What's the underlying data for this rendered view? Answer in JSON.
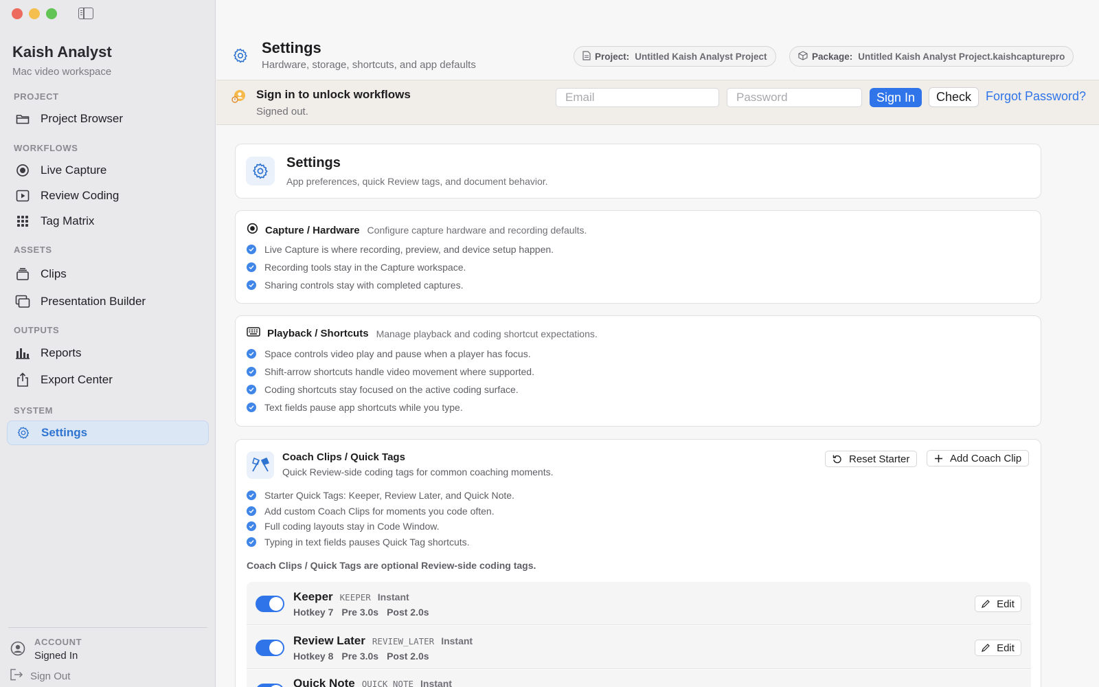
{
  "sidebar": {
    "app_title": "Kaish Analyst",
    "app_subtitle": "Mac video workspace",
    "sections": [
      {
        "label": "PROJECT",
        "items": [
          {
            "label": "Project Browser",
            "icon": "folder-icon"
          }
        ]
      },
      {
        "label": "WORKFLOWS",
        "items": [
          {
            "label": "Live Capture",
            "icon": "record-icon"
          },
          {
            "label": "Review Coding",
            "icon": "play-icon"
          },
          {
            "label": "Tag Matrix",
            "icon": "grid-icon"
          }
        ]
      },
      {
        "label": "ASSETS",
        "items": [
          {
            "label": "Clips",
            "icon": "stack-icon"
          },
          {
            "label": "Presentation Builder",
            "icon": "slides-icon"
          }
        ]
      },
      {
        "label": "OUTPUTS",
        "items": [
          {
            "label": "Reports",
            "icon": "bar-chart-icon"
          },
          {
            "label": "Export Center",
            "icon": "share-icon"
          }
        ]
      },
      {
        "label": "SYSTEM",
        "items": [
          {
            "label": "Settings",
            "icon": "gear-icon",
            "active": true
          }
        ]
      }
    ],
    "account_label": "ACCOUNT",
    "account_status": "Signed In",
    "sign_out_label": "Sign Out"
  },
  "header": {
    "title": "Settings",
    "subtitle": "Hardware, storage, shortcuts, and app defaults",
    "project_key": "Project:",
    "project_value": "Untitled Kaish Analyst Project",
    "package_key": "Package:",
    "package_value": "Untitled Kaish Analyst Project.kaishcapturepro"
  },
  "signin": {
    "title": "Sign in to unlock workflows",
    "status": "Signed out.",
    "email_placeholder": "Email",
    "password_placeholder": "Password",
    "sign_in_label": "Sign In",
    "check_label": "Check",
    "forgot_label": "Forgot Password?"
  },
  "settings_card": {
    "title": "Settings",
    "subtitle": "App preferences, quick Review tags, and document behavior."
  },
  "capture": {
    "title": "Capture / Hardware",
    "desc": "Configure capture hardware and recording defaults.",
    "bullets": [
      "Live Capture is where recording, preview, and device setup happen.",
      "Recording tools stay in the Capture workspace.",
      "Sharing controls stay with completed captures."
    ]
  },
  "playback": {
    "title": "Playback / Shortcuts",
    "desc": "Manage playback and coding shortcut expectations.",
    "bullets": [
      "Space controls video play and pause when a player has focus.",
      "Shift-arrow shortcuts handle video movement where supported.",
      "Coding shortcuts stay focused on the active coding surface.",
      "Text fields pause app shortcuts while you type."
    ]
  },
  "coach": {
    "title": "Coach Clips / Quick Tags",
    "desc": "Quick Review-side coding tags for common coaching moments.",
    "reset_label": "Reset Starter",
    "add_label": "Add Coach Clip",
    "bullets": [
      "Starter Quick Tags: Keeper, Review Later, and Quick Note.",
      "Add custom Coach Clips for moments you code often.",
      "Full coding layouts stay in Code Window.",
      "Typing in text fields pauses Quick Tag shortcuts."
    ],
    "note": "Coach Clips / Quick Tags are optional Review-side coding tags.",
    "edit_label": "Edit",
    "tags": [
      {
        "name": "Keeper",
        "code": "KEEPER",
        "type": "Instant",
        "hotkey": "Hotkey 7",
        "pre": "Pre 3.0s",
        "post": "Post 2.0s",
        "enabled": true
      },
      {
        "name": "Review Later",
        "code": "REVIEW_LATER",
        "type": "Instant",
        "hotkey": "Hotkey 8",
        "pre": "Pre 3.0s",
        "post": "Post 2.0s",
        "enabled": true
      },
      {
        "name": "Quick Note",
        "code": "QUICK_NOTE",
        "type": "Instant",
        "enabled": true
      }
    ]
  },
  "colors": {
    "accent": "#2f74e8",
    "active_nav_bg": "#dce7f6"
  }
}
